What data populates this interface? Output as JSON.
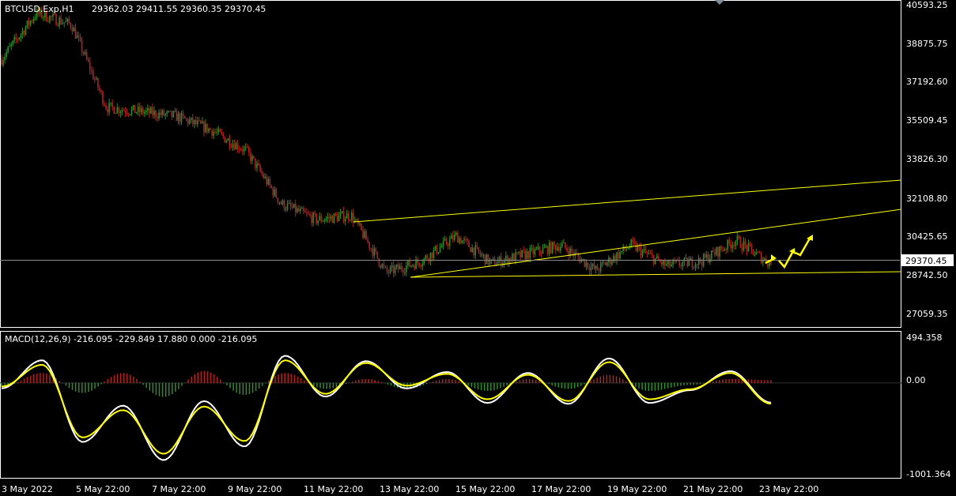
{
  "header": {
    "symbol": "BTCUSD.Exp,H1",
    "ohlc": "29362.03 29411.55 29360.35 29370.45"
  },
  "macd_header": "MACD(12,26,9) -216.095 -229.849 17.880 0.000 -216.095",
  "price_axis": [
    "40593.25",
    "38875.75",
    "37192.60",
    "35509.45",
    "33826.30",
    "32108.80",
    "30425.65",
    "28742.50",
    "27059.35"
  ],
  "current_price_label": "29370.45",
  "macd_axis": [
    "494.358",
    "0.00",
    "-1001.364"
  ],
  "time_axis": [
    "3 May 2022",
    "5 May 22:00",
    "7 May 22:00",
    "9 May 22:00",
    "11 May 22:00",
    "13 May 22:00",
    "15 May 22:00",
    "17 May 22:00",
    "19 May 22:00",
    "21 May 22:00",
    "23 May 22:00"
  ],
  "colors": {
    "background": "#000000",
    "bull_candle": "#2e8b2e",
    "bear_candle": "#b22222",
    "trendline": "#ffff00",
    "macd_line": "#ffffff",
    "signal_line": "#ffff00",
    "hist_positive": "#b22222",
    "hist_negative": "#2e8b2e",
    "axis": "#ffffff"
  },
  "chart_data": [
    {
      "type": "candlestick",
      "title": "BTCUSD.Exp,H1",
      "x_range": [
        "3 May 2022",
        "23 May 22:00"
      ],
      "ylim": [
        26700,
        40800
      ],
      "approx_close_path": [
        {
          "x": "3 May 2022",
          "y": 38300
        },
        {
          "x": "4 May",
          "y": 40300
        },
        {
          "x": "5 May",
          "y": 39800
        },
        {
          "x": "5 May 22:00",
          "y": 36200
        },
        {
          "x": "6 May",
          "y": 36000
        },
        {
          "x": "7 May",
          "y": 35800
        },
        {
          "x": "7 May 22:00",
          "y": 35200
        },
        {
          "x": "8 May",
          "y": 34300
        },
        {
          "x": "9 May",
          "y": 32000
        },
        {
          "x": "9 May 22:00",
          "y": 31300
        },
        {
          "x": "10 May",
          "y": 31500
        },
        {
          "x": "11 May",
          "y": 29000
        },
        {
          "x": "11 May 22:00",
          "y": 29500
        },
        {
          "x": "12 May",
          "y": 30600
        },
        {
          "x": "13 May",
          "y": 29400
        },
        {
          "x": "13 May 22:00",
          "y": 29800
        },
        {
          "x": "15 May",
          "y": 30200
        },
        {
          "x": "17 May",
          "y": 29100
        },
        {
          "x": "19 May",
          "y": 30200
        },
        {
          "x": "20 May",
          "y": 29300
        },
        {
          "x": "21 May",
          "y": 29500
        },
        {
          "x": "22 May",
          "y": 30400
        },
        {
          "x": "23 May",
          "y": 29370
        }
      ],
      "current": 29370.45
    },
    {
      "type": "line",
      "title": "MACD(12,26,9)",
      "ylim": [
        -1001.364,
        494.358
      ],
      "series": [
        {
          "name": "MACD",
          "values": [
            -60,
            250,
            -650,
            -250,
            -850,
            -200,
            -700,
            300,
            -150,
            240,
            -60,
            120,
            -220,
            110,
            -230,
            270,
            -220,
            -80,
            130,
            -216
          ]
        },
        {
          "name": "Signal",
          "values": [
            -40,
            200,
            -600,
            -300,
            -780,
            -260,
            -640,
            250,
            -120,
            220,
            -30,
            100,
            -180,
            90,
            -200,
            230,
            -180,
            -70,
            110,
            -230
          ]
        }
      ]
    }
  ]
}
